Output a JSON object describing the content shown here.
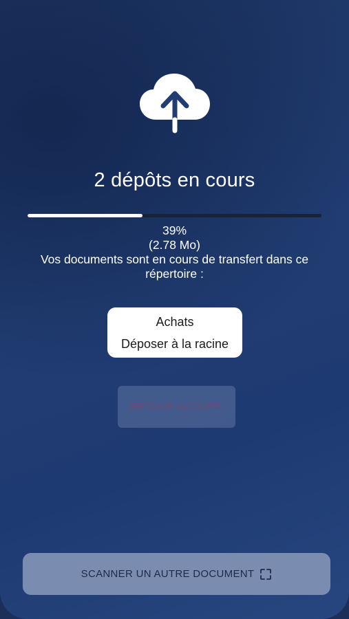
{
  "upload": {
    "title": "2 dépôts en cours",
    "progress_percent": 39,
    "percent_label": "39%",
    "size_label": "(2.78 Mo)",
    "description": "Vos documents sont en cours de transfert dans ce répertoire :"
  },
  "folder": {
    "name": "Achats",
    "path": "Déposer à la racine"
  },
  "buttons": {
    "home": "RETOUR ACCUEIL",
    "scan": "SCANNER UN AUTRE DOCUMENT"
  },
  "icons": {
    "upload": "cloud-upload-icon",
    "scan": "scan-frame-icon"
  },
  "colors": {
    "background": "#213d72",
    "progress_fill": "#ffffff",
    "progress_track": "#1a2238",
    "home_button_text": "#6d4a6e",
    "scan_button_bg": "#7a8cb0"
  }
}
